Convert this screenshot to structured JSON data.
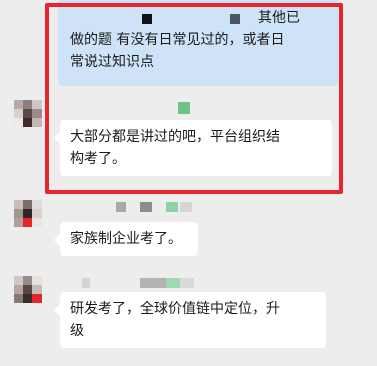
{
  "colors": {
    "background": "#ededed",
    "quote_bubble": "#cfe3f8",
    "bubble": "#ffffff",
    "highlight": "#e5262d",
    "mosaic_green": "#6cc48a"
  },
  "quote": {
    "line1": "其他已",
    "line2": "做的题 有没有日常见过的，或者日",
    "line3": "常说过知识点"
  },
  "messages": [
    {
      "line1": "大部分都是讲过的吧，平台组织结",
      "line2": "构考了。"
    },
    {
      "line1": "家族制企业考了。"
    },
    {
      "line1": "研发考了，全球价值链中定位，升",
      "line2": "级"
    }
  ]
}
